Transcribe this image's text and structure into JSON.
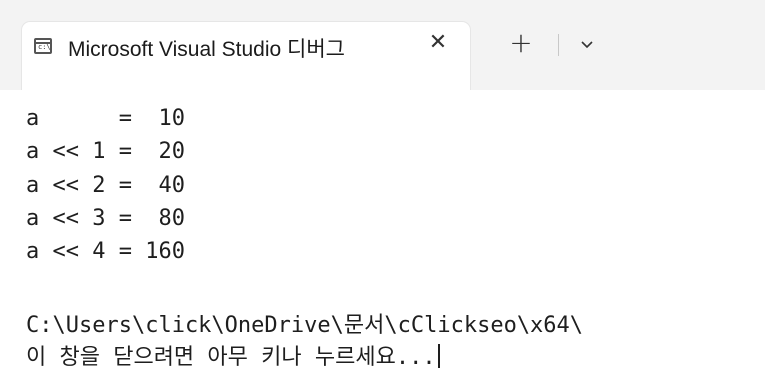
{
  "tab": {
    "title": "Microsoft Visual Studio 디버그",
    "icon_text": "c:\\",
    "close_glyph": "✕",
    "new_tab_glyph": "+"
  },
  "console": {
    "lines": [
      "a      =  10",
      "a << 1 =  20",
      "a << 2 =  40",
      "a << 3 =  80",
      "a << 4 = 160",
      "C:\\Users\\click\\OneDrive\\문서\\cClickseo\\x64\\",
      "이 창을 닫으려면 아무 키나 누르세요..."
    ]
  },
  "colors": {
    "tabstrip": "#f3f3f3",
    "background": "#ffffff",
    "text": "#1e1e1e"
  }
}
